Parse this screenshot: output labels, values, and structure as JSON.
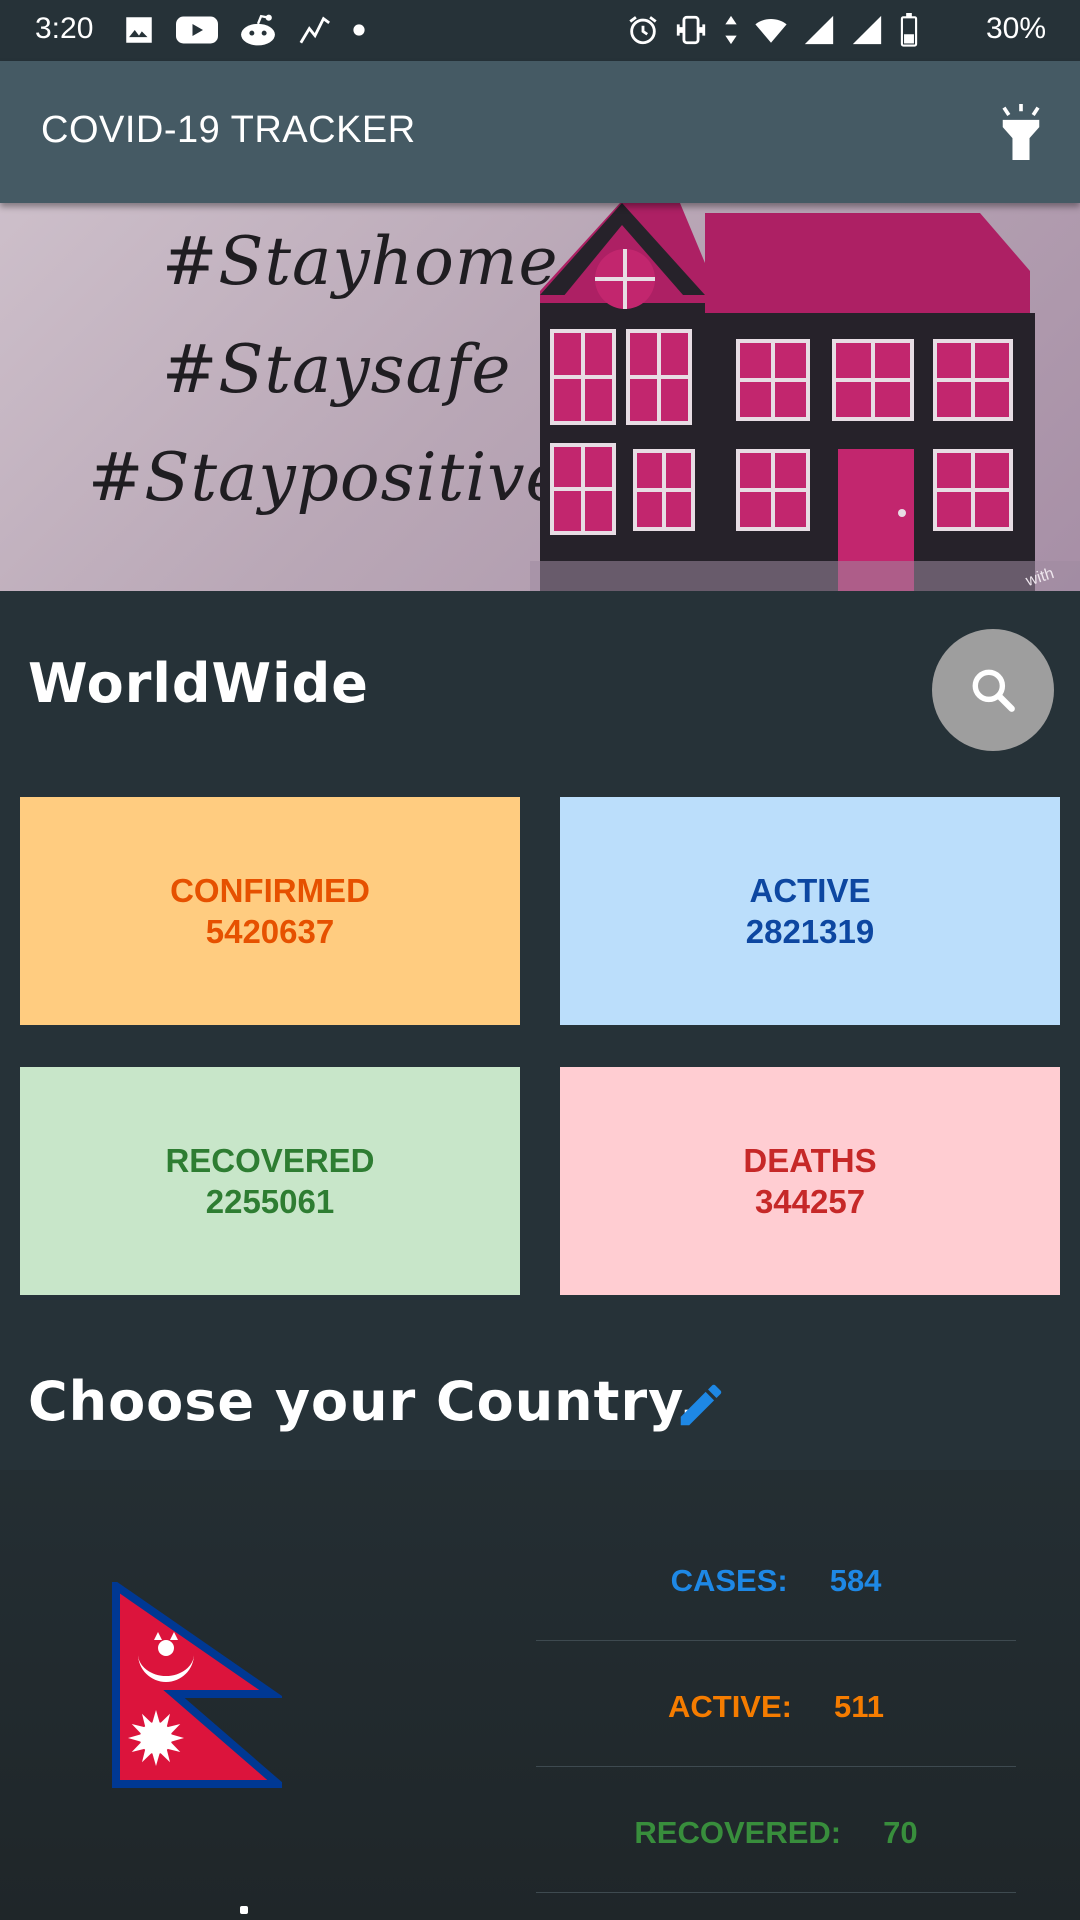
{
  "status_bar": {
    "time": "3:20",
    "battery": "30%",
    "left_icons": [
      "image-icon",
      "youtube-icon",
      "reddit-icon",
      "chart-icon",
      "dot-icon"
    ],
    "right_icons": [
      "alarm-icon",
      "vibrate-icon",
      "data-arrows-icon",
      "wifi-icon",
      "signal-icon",
      "signal-icon",
      "battery-icon"
    ]
  },
  "app_bar": {
    "title": "COVID-19 TRACKER",
    "action_icon": "flashlight-icon"
  },
  "banner": {
    "lines": [
      "#Stayhome",
      "#Staysafe",
      "#Staypositive"
    ],
    "watermark": "with"
  },
  "worldwide": {
    "title": "WorldWide",
    "search_icon": "search-icon",
    "cards": {
      "confirmed": {
        "label": "CONFIRMED",
        "value": "5420637",
        "bg": "#FFCC80",
        "color": "#E65100"
      },
      "active": {
        "label": "ACTIVE",
        "value": "2821319",
        "bg": "#BBDEFB",
        "color": "#0D47A1"
      },
      "recovered": {
        "label": "RECOVERED",
        "value": "2255061",
        "bg": "#C8E6C9",
        "color": "#2E7D32"
      },
      "deaths": {
        "label": "DEATHS",
        "value": "344257",
        "bg": "#FFCDD2",
        "color": "#C62828"
      }
    }
  },
  "country": {
    "title": "Choose your Country.",
    "edit_icon": "edit-icon",
    "flag": "nepal-flag",
    "stats": {
      "cases": {
        "label": "CASES:",
        "value": "584",
        "color": "#1E88E5"
      },
      "active": {
        "label": "ACTIVE:",
        "value": "511",
        "color": "#F57C00"
      },
      "recovered": {
        "label": "RECOVERED:",
        "value": "70",
        "color": "#388E3C"
      }
    }
  },
  "colors": {
    "background": "#263238",
    "app_bar": "#455A64",
    "fab": "#9E9E9E",
    "accent_blue": "#1E88E5"
  }
}
